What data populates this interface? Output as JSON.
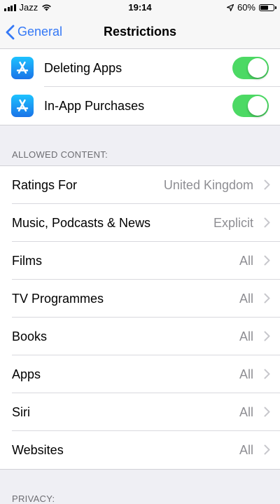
{
  "status": {
    "carrier": "Jazz",
    "time": "19:14",
    "battery": "60%",
    "battery_level": 0.6
  },
  "nav": {
    "back_label": "General",
    "title": "Restrictions"
  },
  "toggles": [
    {
      "label": "Deleting Apps",
      "icon": "app-store-icon",
      "on": true
    },
    {
      "label": "In-App Purchases",
      "icon": "app-store-icon",
      "on": true
    }
  ],
  "allowed_content": {
    "header": "ALLOWED CONTENT:",
    "items": [
      {
        "label": "Ratings For",
        "value": "United Kingdom"
      },
      {
        "label": "Music, Podcasts & News",
        "value": "Explicit"
      },
      {
        "label": "Films",
        "value": "All"
      },
      {
        "label": "TV Programmes",
        "value": "All"
      },
      {
        "label": "Books",
        "value": "All"
      },
      {
        "label": "Apps",
        "value": "All"
      },
      {
        "label": "Siri",
        "value": "All"
      },
      {
        "label": "Websites",
        "value": "All"
      }
    ]
  },
  "next_section_header": "PRIVACY:",
  "colors": {
    "accent": "#3478f6",
    "toggle_on": "#4cd964",
    "background": "#efeff4"
  }
}
